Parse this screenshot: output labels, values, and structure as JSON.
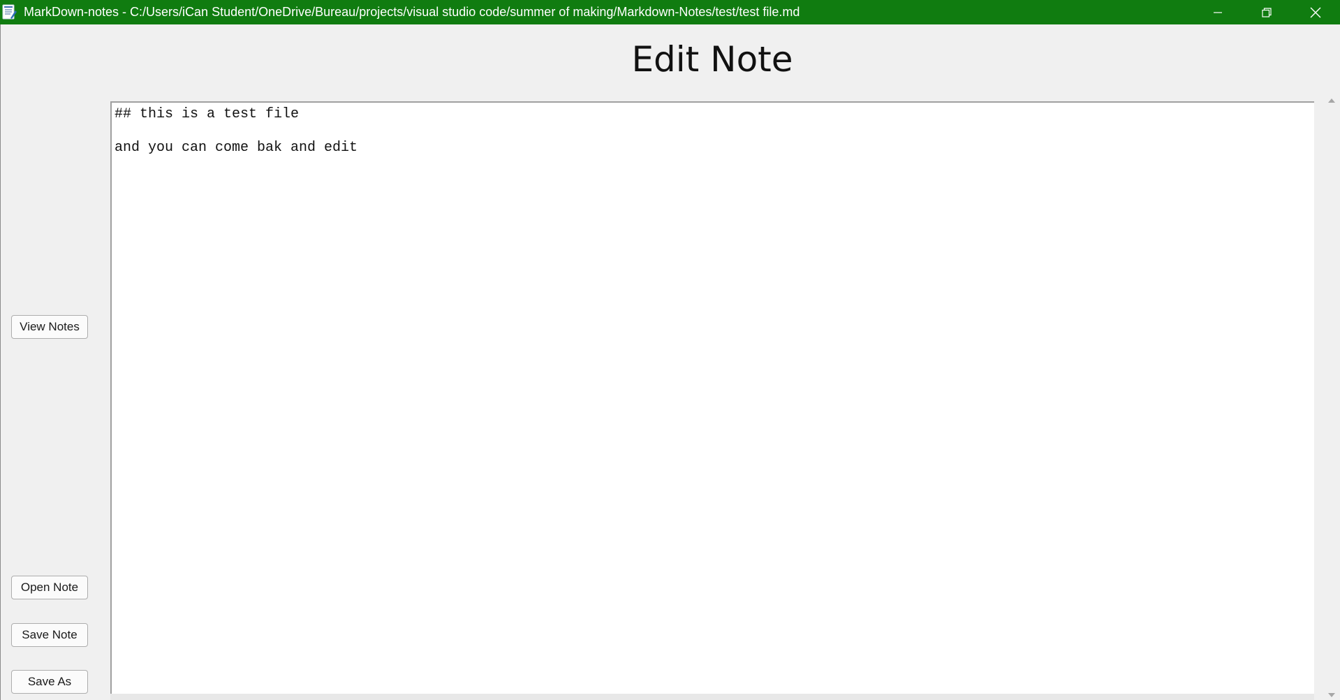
{
  "window": {
    "title": "MarkDown-notes - C:/Users/iCan Student/OneDrive/Bureau/projects/visual studio code/summer of making/Markdown-Notes/test/test file.md",
    "titlebar_color": "#107c10",
    "controls": {
      "minimize_icon": "minimize-icon",
      "restore_icon": "restore-icon",
      "close_icon": "close-icon"
    }
  },
  "page": {
    "heading": "Edit Note"
  },
  "sidebar": {
    "view_notes_label": "View Notes",
    "open_note_label": "Open Note",
    "save_note_label": "Save Note",
    "save_as_label": "Save As"
  },
  "editor": {
    "content": "## this is a test file\n\nand you can come bak and edit"
  },
  "scrollbar": {
    "up_icon": "scroll-up-arrow-icon",
    "down_icon": "scroll-down-arrow-icon"
  }
}
